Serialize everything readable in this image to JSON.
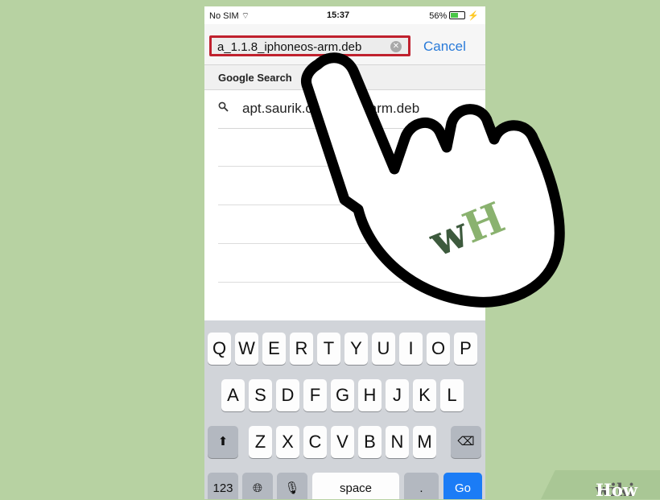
{
  "status_bar": {
    "carrier": "No SIM",
    "time": "15:37",
    "battery": "56%"
  },
  "search": {
    "url_value": "a_1.1.8_iphoneos-arm.deb",
    "cancel_label": "Cancel"
  },
  "suggestions": {
    "header": "Google Search",
    "items": [
      {
        "text": "apt.saurik.com...eos-arm.deb"
      }
    ]
  },
  "keyboard": {
    "row1": [
      "Q",
      "W",
      "E",
      "R",
      "T",
      "Y",
      "U",
      "I",
      "O",
      "P"
    ],
    "row2": [
      "A",
      "S",
      "D",
      "F",
      "G",
      "H",
      "J",
      "K",
      "L"
    ],
    "row3": [
      "Z",
      "X",
      "C",
      "V",
      "B",
      "N",
      "M"
    ],
    "numbers_label": "123",
    "space_label": "space",
    "dot_label": ".",
    "go_label": "Go"
  },
  "watermark": {
    "wiki": "wiki",
    "how": "How",
    "logo": "wH"
  },
  "colors": {
    "background": "#b7d2a2",
    "highlight": "#c0212e",
    "accent": "#2a7bd9",
    "go": "#1b7cf6"
  }
}
